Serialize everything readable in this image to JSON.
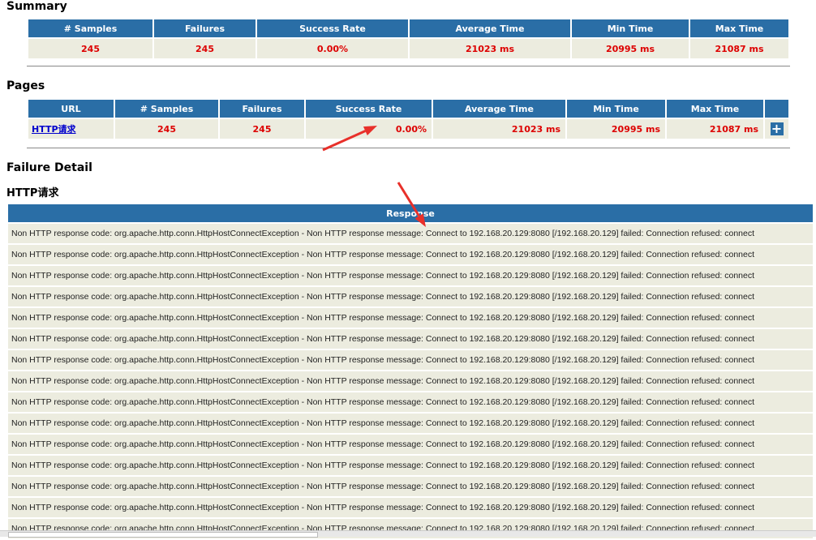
{
  "summary": {
    "title": "Summary",
    "headers": [
      "# Samples",
      "Failures",
      "Success Rate",
      "Average Time",
      "Min Time",
      "Max Time"
    ],
    "values": [
      "245",
      "245",
      "0.00%",
      "21023 ms",
      "20995 ms",
      "21087 ms"
    ]
  },
  "pages": {
    "title": "Pages",
    "headers": [
      "URL",
      "# Samples",
      "Failures",
      "Success Rate",
      "Average Time",
      "Min Time",
      "Max Time",
      ""
    ],
    "row": {
      "url": "HTTP请求",
      "samples": "245",
      "failures": "245",
      "success_rate": "0.00%",
      "avg": "21023 ms",
      "min": "20995 ms",
      "max": "21087 ms",
      "expand": "+"
    }
  },
  "failure": {
    "title": "Failure Detail",
    "subtitle": "HTTP请求",
    "header": "Response",
    "rows": [
      "Non HTTP response code: org.apache.http.conn.HttpHostConnectException - Non HTTP response message: Connect to 192.168.20.129:8080 [/192.168.20.129] failed: Connection refused: connect"
    ],
    "row_count": 15
  },
  "annotation_color": "#e8302a"
}
